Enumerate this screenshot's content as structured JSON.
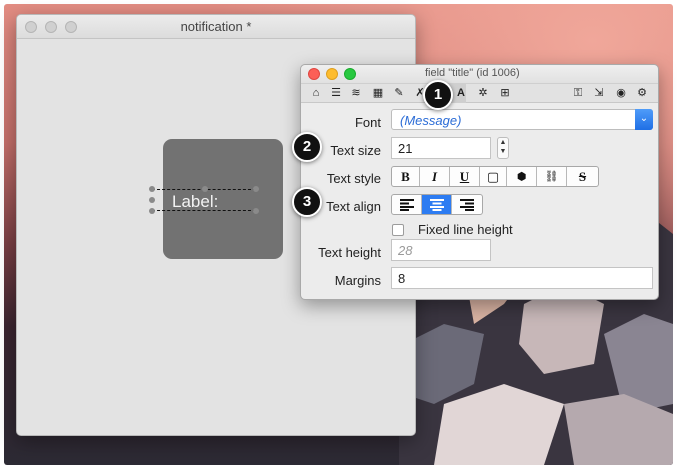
{
  "main_window": {
    "title": "notification *",
    "canvas": {
      "label_text": "Label:"
    }
  },
  "inspector": {
    "title": "field \"title\" (id 1006)",
    "font": {
      "label": "Font",
      "value": "(Message)"
    },
    "text_size": {
      "label": "Text size",
      "value": "21"
    },
    "text_style": {
      "label": "Text style",
      "buttons": [
        "B",
        "I",
        "U",
        "▢",
        "⬢",
        "⛓",
        "S"
      ]
    },
    "text_align": {
      "label": "Text align",
      "selected": "center"
    },
    "fixed_line_height": {
      "label": "Fixed line height",
      "checked": false
    },
    "text_height": {
      "label": "Text height",
      "placeholder": "28"
    },
    "margins": {
      "label": "Margins",
      "value": "8"
    }
  },
  "callouts": [
    "1",
    "2",
    "3"
  ],
  "colors": {
    "accent": "#2d7cf2",
    "close": "#fc5f57",
    "minimize": "#fdbc2e",
    "zoom": "#28c840"
  }
}
